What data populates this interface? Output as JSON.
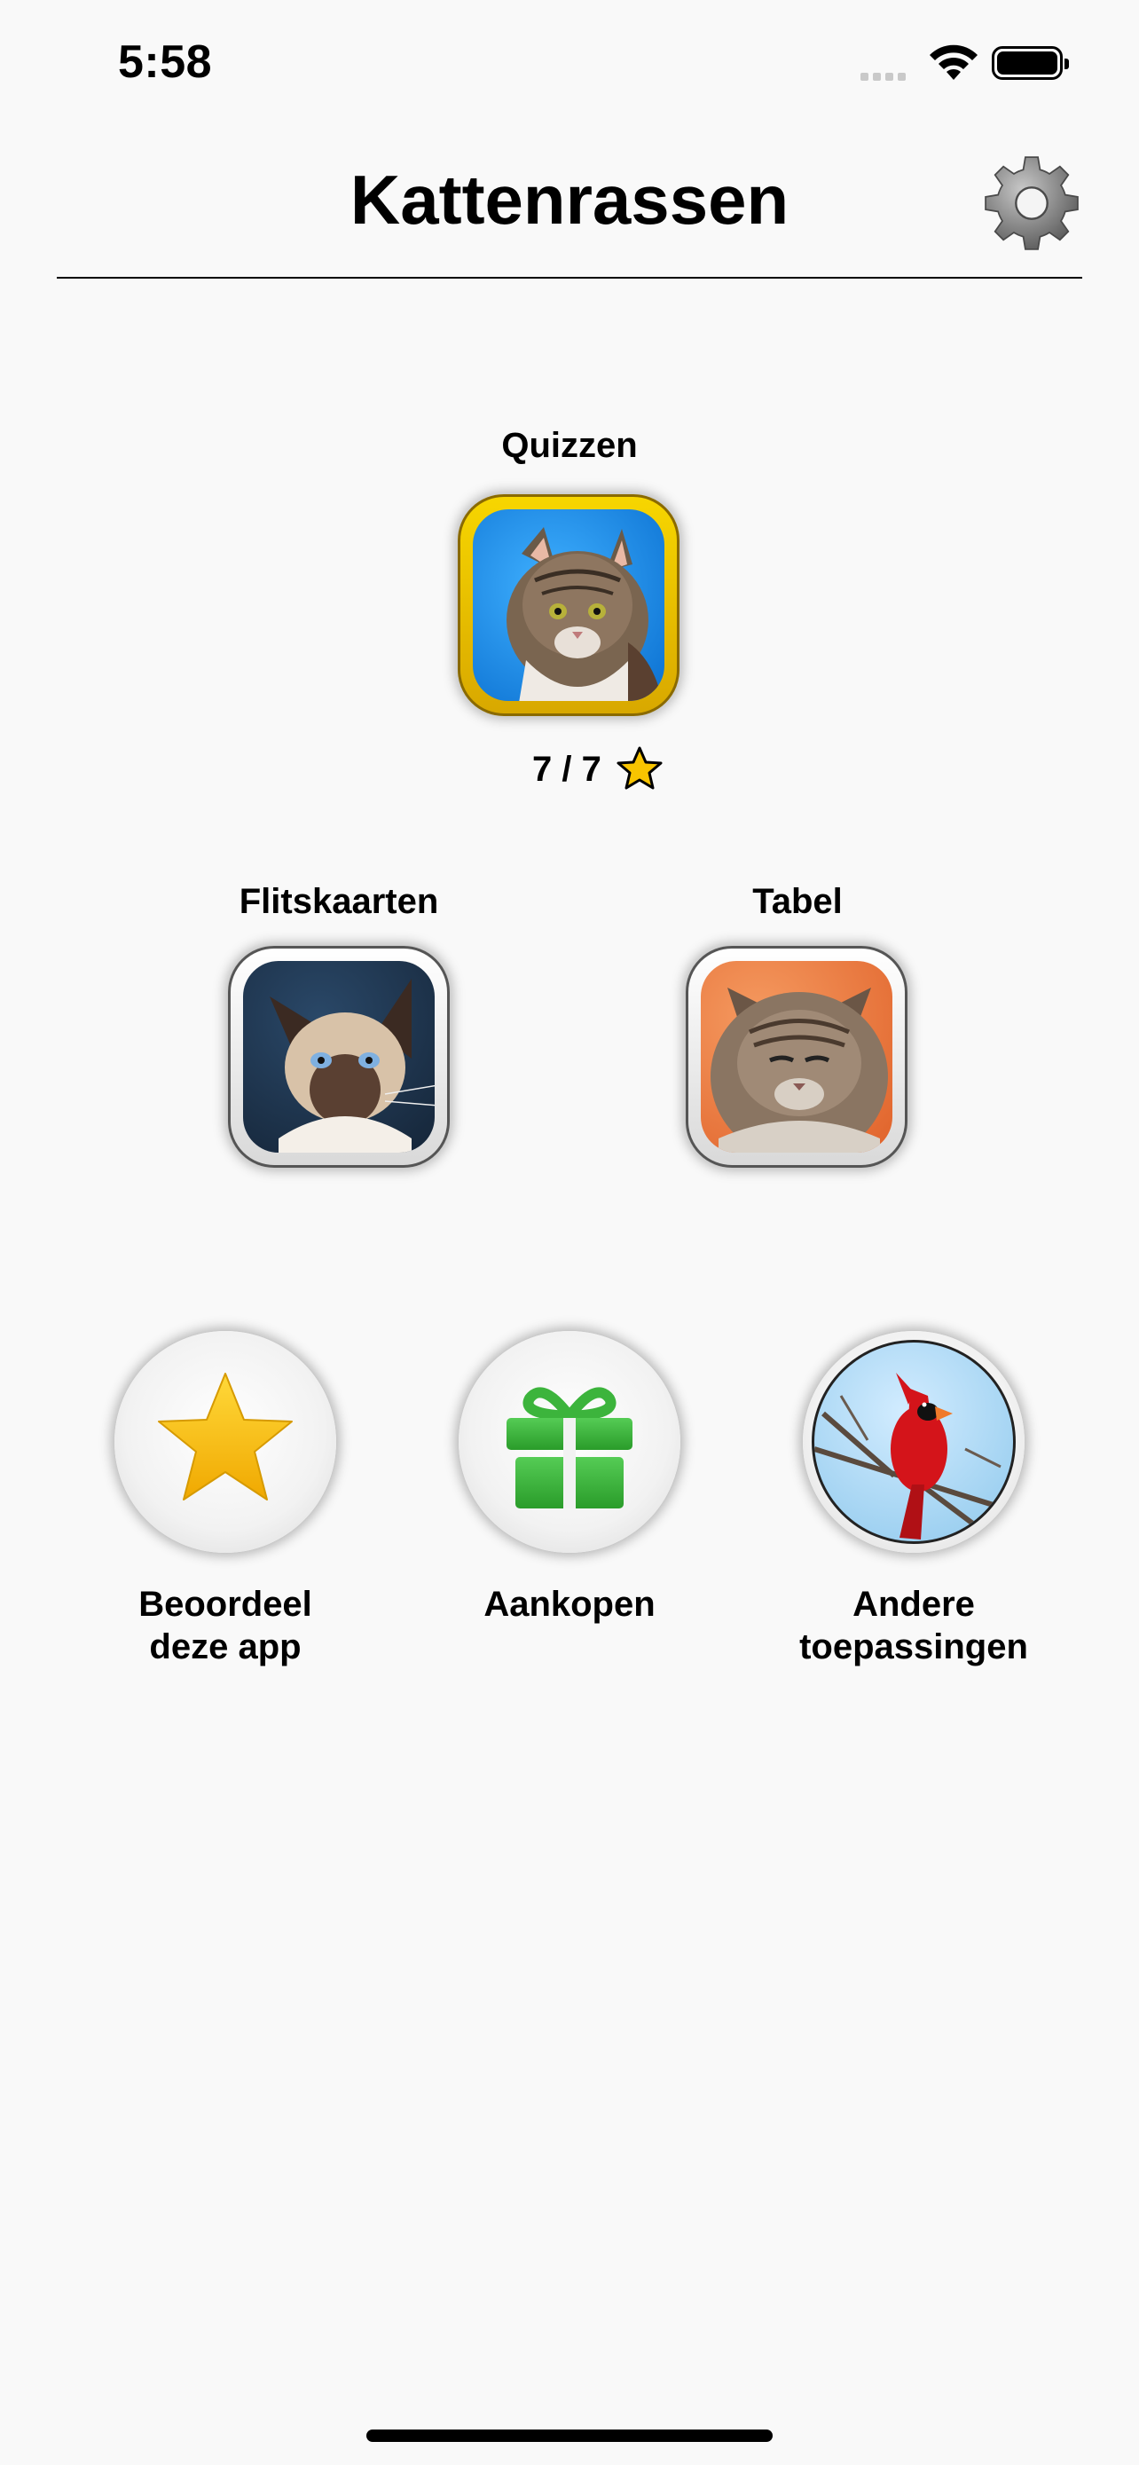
{
  "status_bar": {
    "time": "5:58"
  },
  "header": {
    "title": "Kattenrassen",
    "settings_icon": "gear-icon"
  },
  "main": {
    "quiz": {
      "label": "Quizzen",
      "score": "7 / 7",
      "score_icon": "star-icon"
    },
    "flashcards": {
      "label": "Flitskaarten"
    },
    "table": {
      "label": "Tabel"
    }
  },
  "bottom": {
    "rate": {
      "line1": "Beoordeel",
      "line2": "deze app",
      "icon": "star-icon"
    },
    "purchases": {
      "label": "Aankopen",
      "icon": "gift-icon"
    },
    "other": {
      "line1": "Andere",
      "line2": "toepassingen",
      "icon": "cardinal-bird-image"
    }
  },
  "colors": {
    "quiz_bg": "#1a8fe0",
    "quiz_border": "#f0c400",
    "table_bg": "#e8773a",
    "flash_bg": "#1f3550",
    "gift_green": "#3cb43c",
    "star_yellow": "#f8c400",
    "cardinal_red": "#d4141a"
  }
}
